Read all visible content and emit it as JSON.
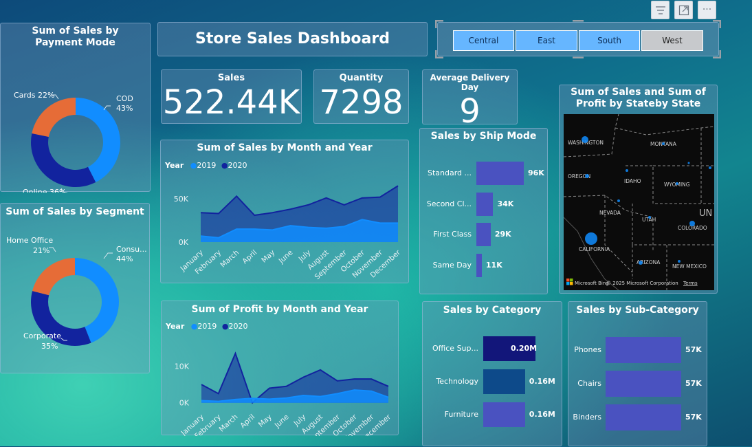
{
  "toolbar": {
    "filter_icon": "filter-lines-icon",
    "focus_icon": "focus-mode-icon",
    "more_icon": "more-options-icon",
    "more_label": "···"
  },
  "title": "Store Sales Dashboard",
  "region_slicer": {
    "options": [
      "Central",
      "East",
      "South",
      "West"
    ],
    "colors": {
      "selected": "#66b6ff",
      "unselected": "#c7c9cc"
    }
  },
  "payment_mode": {
    "title": "Sum of Sales by Payment Mode",
    "chart_data": {
      "type": "pie",
      "slices": [
        {
          "name": "COD",
          "label": "COD",
          "value": 43,
          "pct": "43%",
          "color": "#118dff"
        },
        {
          "name": "Online",
          "label": "Online 36%",
          "value": 36,
          "pct": "36%",
          "color": "#12239e"
        },
        {
          "name": "Cards",
          "label": "Cards 22%",
          "value": 22,
          "pct": "22%",
          "color": "#e66c37"
        }
      ]
    }
  },
  "segment": {
    "title": "Sum of Sales by Segment",
    "chart_data": {
      "type": "pie",
      "slices": [
        {
          "name": "Consumer",
          "label": "Consu...",
          "value": 44,
          "pct": "44%",
          "color": "#118dff"
        },
        {
          "name": "Corporate",
          "label": "Corporate",
          "value": 35,
          "pct": "35%",
          "color": "#12239e"
        },
        {
          "name": "Home Office",
          "label": "Home Office",
          "value": 21,
          "pct": "21%",
          "color": "#e66c37"
        }
      ]
    }
  },
  "kpis": {
    "sales": {
      "label": "Sales",
      "value": "522.44K"
    },
    "quantity": {
      "label": "Quantity",
      "value": "7298"
    },
    "delivery": {
      "label": "Average Delivery Day",
      "value": "9"
    }
  },
  "sales_by_month": {
    "title": "Sum of Sales by Month and Year",
    "legend_title": "Year",
    "chart_data": {
      "type": "area",
      "categories": [
        "January",
        "February",
        "March",
        "April",
        "May",
        "June",
        "July",
        "August",
        "September",
        "October",
        "November",
        "December"
      ],
      "yticks": [
        "50K",
        "0K"
      ],
      "ylim": [
        0,
        62000
      ],
      "series": [
        {
          "name": "2019",
          "color": "#118dff",
          "values": [
            7000,
            5000,
            15000,
            15000,
            14000,
            19000,
            17000,
            16000,
            18000,
            26000,
            22000,
            22000
          ]
        },
        {
          "name": "2020",
          "color": "#12239e",
          "values": [
            34000,
            33000,
            53000,
            31000,
            34000,
            38000,
            43000,
            51000,
            43000,
            51000,
            52000,
            65000
          ]
        }
      ]
    }
  },
  "profit_by_month": {
    "title": "Sum of Profit by Month and Year",
    "legend_title": "Year",
    "chart_data": {
      "type": "area",
      "categories": [
        "January",
        "February",
        "March",
        "April",
        "May",
        "June",
        "July",
        "August",
        "September",
        "October",
        "November",
        "December"
      ],
      "yticks": [
        "10K",
        "0K"
      ],
      "ylim": [
        -1000,
        15000
      ],
      "series": [
        {
          "name": "2019",
          "color": "#118dff",
          "values": [
            600,
            400,
            900,
            1200,
            1000,
            1300,
            2000,
            1700,
            2500,
            3500,
            3200,
            1500
          ]
        },
        {
          "name": "2020",
          "color": "#12239e",
          "values": [
            5000,
            2500,
            13500,
            0,
            4000,
            4500,
            7000,
            9000,
            6000,
            6500,
            6500,
            4500
          ]
        }
      ]
    }
  },
  "ship_mode": {
    "title": "Sales by Ship Mode",
    "chart_data": {
      "type": "bar",
      "categories": [
        "Standard ...",
        "Second Cl...",
        "First Class",
        "Same Day"
      ],
      "values": [
        96,
        34,
        29,
        11
      ],
      "labels": [
        "96K",
        "34K",
        "29K",
        "11K"
      ],
      "color": "#4a52c0"
    }
  },
  "map": {
    "title": "Sum of Sales and Sum of Profit by Stateby State",
    "labels": [
      "WASHINGTON",
      "MONTANA",
      "OREGON",
      "IDAHO",
      "WYOMING",
      "NEVADA",
      "UTAH",
      "COLORADO",
      "CALIFORNIA",
      "ARIZONA",
      "NEW MEXICO",
      "UN"
    ],
    "attribution": "© 2025 Microsoft Corporation",
    "terms": "Terms",
    "brand": "Microsoft Bing"
  },
  "category": {
    "title": "Sales by Category",
    "chart_data": {
      "type": "bar",
      "categories": [
        "Office Sup...",
        "Technology",
        "Furniture"
      ],
      "values": [
        0.2,
        0.16,
        0.16
      ],
      "labels": [
        "0.20M",
        "0.16M",
        "0.16M"
      ],
      "colors": [
        "#12167a",
        "#0d4a8a",
        "#4a52c0"
      ]
    }
  },
  "sub_category": {
    "title": "Sales by Sub-Category",
    "chart_data": {
      "type": "bar",
      "categories": [
        "Phones",
        "Chairs",
        "Binders"
      ],
      "values": [
        57,
        57,
        57
      ],
      "labels": [
        "57K",
        "57K",
        "57K"
      ],
      "color": "#4a52c0"
    }
  }
}
